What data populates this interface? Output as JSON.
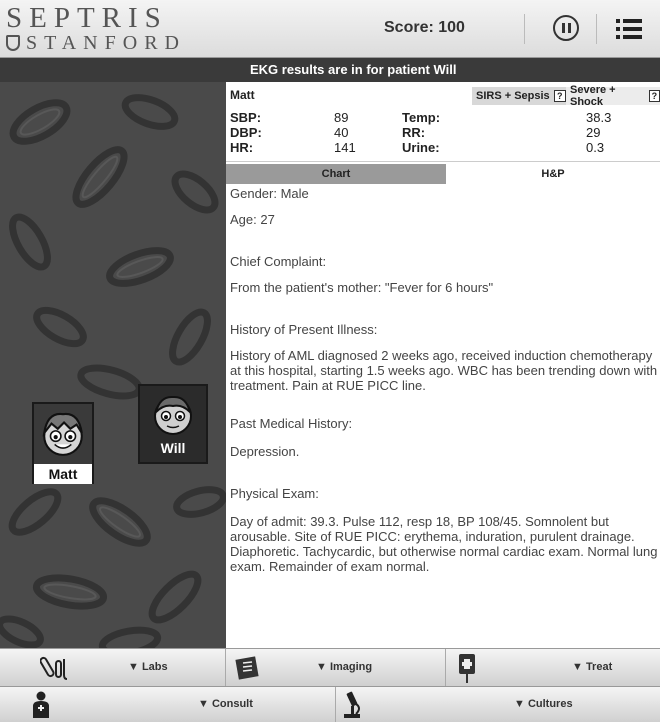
{
  "header": {
    "logo_line1": "SEPTRIS",
    "logo_line2": "STANFORD",
    "score": "Score: 100"
  },
  "notice": "EKG results are in for patient Will",
  "patients": [
    {
      "name": "Matt"
    },
    {
      "name": "Will"
    }
  ],
  "vitals": {
    "patient_name": "Matt",
    "chips": [
      "SIRS + Sepsis",
      "Severe + Shock"
    ],
    "rows": [
      {
        "l1": "SBP:",
        "v1": "89",
        "l2": "Temp:",
        "v2": "38.3"
      },
      {
        "l1": "DBP:",
        "v1": "40",
        "l2": "RR:",
        "v2": "29"
      },
      {
        "l1": "HR:",
        "v1": "141",
        "l2": "Urine:",
        "v2": "0.3"
      }
    ]
  },
  "tabs": [
    "Chart",
    "H&P"
  ],
  "hp": {
    "gender": "Gender: Male",
    "age": "Age: 27",
    "cc_head": "Chief Complaint:",
    "cc": "From the patient's mother: \"Fever for 6 hours\"",
    "hpi_head": "History of Present Illness:",
    "hpi": "History of AML diagnosed 2 weeks ago, received induction chemotherapy at this hospital, starting 1.5 weeks ago. WBC has been trending down with treatment. Pain at RUE PICC line.",
    "pmh_head": "Past Medical History:",
    "pmh": "Depression.",
    "pe_head": "Physical Exam:",
    "pe": "Day of admit: 39.3. Pulse 112, resp 18, BP 108/45. Somnolent but arousable. Site of RUE PICC: erythema, induration, purulent drainage. Diaphoretic. Tachycardic, but otherwise normal cardiac exam. Normal lung exam. Remainder of exam normal."
  },
  "toolbar1": [
    "▼ Labs",
    "▼ Imaging",
    "▼ Treat"
  ],
  "toolbar2": [
    "▼ Consult",
    "▼ Cultures"
  ],
  "icons": [
    "test-tubes-icon",
    "xray-film-icon",
    "iv-bag-icon",
    "doctor-icon",
    "microscope-icon"
  ]
}
